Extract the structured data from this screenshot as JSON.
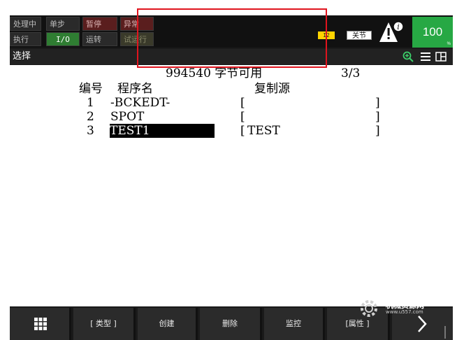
{
  "status": {
    "row1": [
      "处理中",
      "单步",
      "暂停",
      "异常"
    ],
    "row2": [
      "执行",
      "I/O",
      "运转",
      "试运行"
    ],
    "badge_i2": "I2",
    "coord": "关节",
    "override": "100",
    "override_unit": "%"
  },
  "titlebar": {
    "title": "选择"
  },
  "program_list": {
    "free_memory_line": "994540 字节可用",
    "count": "3/3",
    "col_number": "编号",
    "col_name": "程序名",
    "col_copy_source": "复制源",
    "rows": [
      {
        "num": "1",
        "name": "-BCKEDT-",
        "source_open": "[",
        "source": "",
        "source_close": "]"
      },
      {
        "num": "2",
        "name": "SPOT",
        "source_open": "[",
        "source": "",
        "source_close": "]"
      },
      {
        "num": "3",
        "name": "TEST1",
        "source_open": "[",
        "source": "TEST",
        "source_close": "]"
      }
    ]
  },
  "fkeys": {
    "menu_icon": "grid-icon",
    "type": "[ 类型 ]",
    "create": "创建",
    "delete": "删除",
    "monitor": "监控",
    "attribute": "[属性 ]",
    "next": "next-icon"
  },
  "watermark": {
    "name": "机械资源网",
    "url": "www.u557.com"
  },
  "colors": {
    "override_green": "#27a844",
    "annotation_red": "#e0141e",
    "i2_yellow": "#ffd400"
  }
}
